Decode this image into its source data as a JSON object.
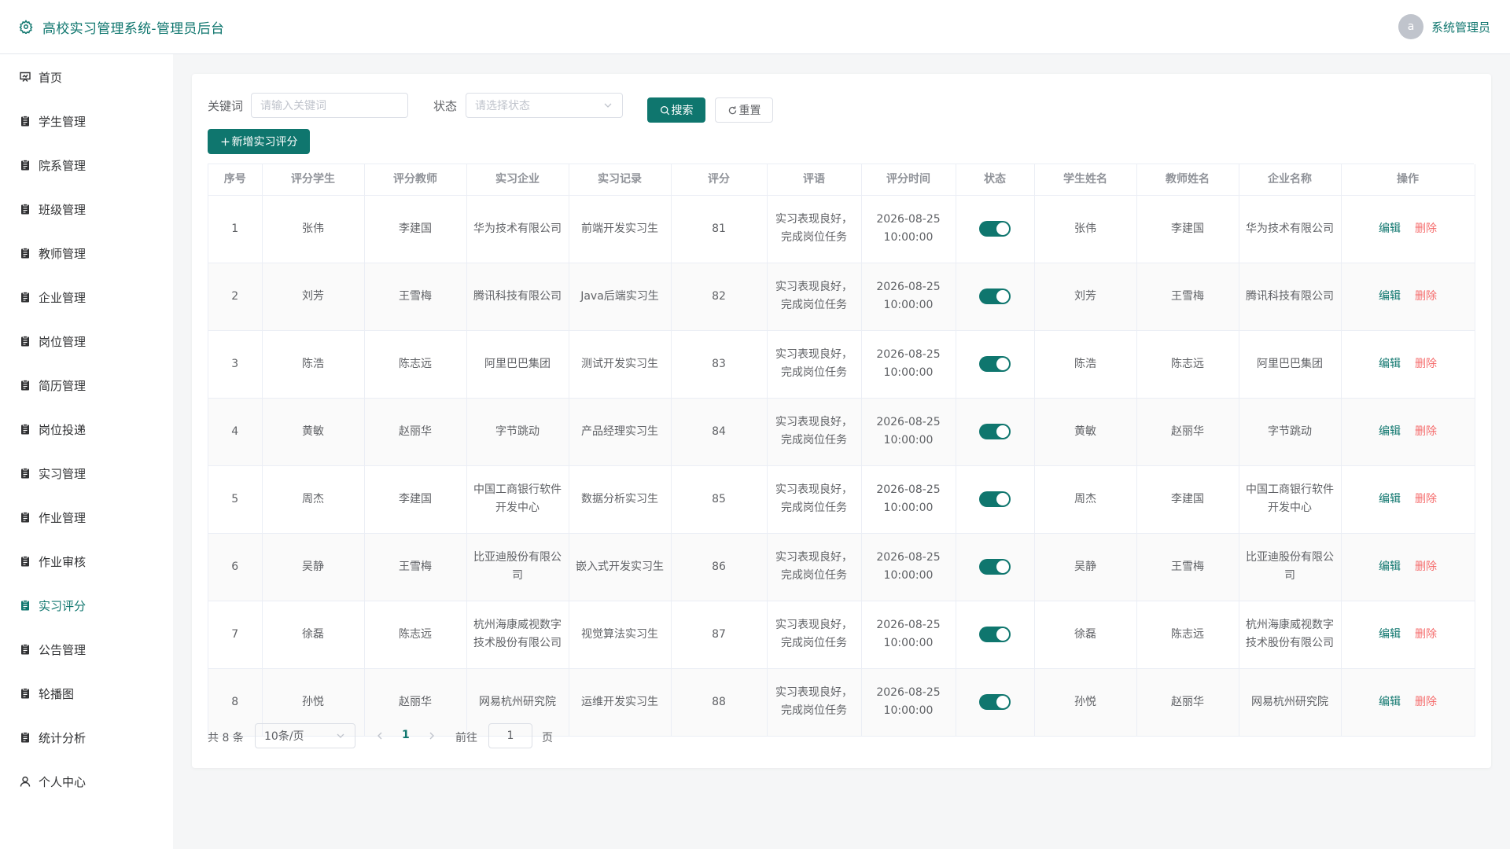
{
  "header": {
    "title": "高校实习管理系统-管理员后台",
    "avatar_letter": "a",
    "user_name": "系统管理员"
  },
  "sidebar": {
    "items": [
      {
        "label": "首页",
        "icon": "home-icon"
      },
      {
        "label": "学生管理",
        "icon": "clipboard-icon"
      },
      {
        "label": "院系管理",
        "icon": "clipboard-icon"
      },
      {
        "label": "班级管理",
        "icon": "clipboard-icon"
      },
      {
        "label": "教师管理",
        "icon": "clipboard-icon"
      },
      {
        "label": "企业管理",
        "icon": "clipboard-icon"
      },
      {
        "label": "岗位管理",
        "icon": "clipboard-icon"
      },
      {
        "label": "简历管理",
        "icon": "clipboard-icon"
      },
      {
        "label": "岗位投递",
        "icon": "clipboard-icon"
      },
      {
        "label": "实习管理",
        "icon": "clipboard-icon"
      },
      {
        "label": "作业管理",
        "icon": "clipboard-icon"
      },
      {
        "label": "作业审核",
        "icon": "clipboard-icon"
      },
      {
        "label": "实习评分",
        "icon": "clipboard-icon",
        "active": true
      },
      {
        "label": "公告管理",
        "icon": "clipboard-icon"
      },
      {
        "label": "轮播图",
        "icon": "clipboard-icon"
      },
      {
        "label": "统计分析",
        "icon": "clipboard-icon"
      },
      {
        "label": "个人中心",
        "icon": "user-icon"
      }
    ]
  },
  "filters": {
    "keyword_label": "关键词",
    "keyword_placeholder": "请输入关键词",
    "status_label": "状态",
    "status_placeholder": "请选择状态",
    "search_label": "搜索",
    "reset_label": "重置",
    "add_label": "新增实习评分"
  },
  "table": {
    "columns": [
      "序号",
      "评分学生",
      "评分教师",
      "实习企业",
      "实习记录",
      "评分",
      "评语",
      "评分时间",
      "状态",
      "学生姓名",
      "教师姓名",
      "企业名称",
      "操作"
    ],
    "rows": [
      {
        "no": "1",
        "student": "张伟",
        "teacher": "李建国",
        "company": "华为技术有限公司",
        "record": "前端开发实习生",
        "score": "81",
        "comment": "实习表现良好，完成岗位任务",
        "time": "2026-08-25 10:00:00",
        "status": true,
        "student_name": "张伟",
        "teacher_name": "李建国",
        "company_name": "华为技术有限公司"
      },
      {
        "no": "2",
        "student": "刘芳",
        "teacher": "王雪梅",
        "company": "腾讯科技有限公司",
        "record": "Java后端实习生",
        "score": "82",
        "comment": "实习表现良好，完成岗位任务",
        "time": "2026-08-25 10:00:00",
        "status": true,
        "student_name": "刘芳",
        "teacher_name": "王雪梅",
        "company_name": "腾讯科技有限公司"
      },
      {
        "no": "3",
        "student": "陈浩",
        "teacher": "陈志远",
        "company": "阿里巴巴集团",
        "record": "测试开发实习生",
        "score": "83",
        "comment": "实习表现良好，完成岗位任务",
        "time": "2026-08-25 10:00:00",
        "status": true,
        "student_name": "陈浩",
        "teacher_name": "陈志远",
        "company_name": "阿里巴巴集团"
      },
      {
        "no": "4",
        "student": "黄敏",
        "teacher": "赵丽华",
        "company": "字节跳动",
        "record": "产品经理实习生",
        "score": "84",
        "comment": "实习表现良好，完成岗位任务",
        "time": "2026-08-25 10:00:00",
        "status": true,
        "student_name": "黄敏",
        "teacher_name": "赵丽华",
        "company_name": "字节跳动"
      },
      {
        "no": "5",
        "student": "周杰",
        "teacher": "李建国",
        "company": "中国工商银行软件开发中心",
        "record": "数据分析实习生",
        "score": "85",
        "comment": "实习表现良好，完成岗位任务",
        "time": "2026-08-25 10:00:00",
        "status": true,
        "student_name": "周杰",
        "teacher_name": "李建国",
        "company_name": "中国工商银行软件开发中心"
      },
      {
        "no": "6",
        "student": "吴静",
        "teacher": "王雪梅",
        "company": "比亚迪股份有限公司",
        "record": "嵌入式开发实习生",
        "score": "86",
        "comment": "实习表现良好，完成岗位任务",
        "time": "2026-08-25 10:00:00",
        "status": true,
        "student_name": "吴静",
        "teacher_name": "王雪梅",
        "company_name": "比亚迪股份有限公司"
      },
      {
        "no": "7",
        "student": "徐磊",
        "teacher": "陈志远",
        "company": "杭州海康威视数字技术股份有限公司",
        "record": "视觉算法实习生",
        "score": "87",
        "comment": "实习表现良好，完成岗位任务",
        "time": "2026-08-25 10:00:00",
        "status": true,
        "student_name": "徐磊",
        "teacher_name": "陈志远",
        "company_name": "杭州海康威视数字技术股份有限公司"
      },
      {
        "no": "8",
        "student": "孙悦",
        "teacher": "赵丽华",
        "company": "网易杭州研究院",
        "record": "运维开发实习生",
        "score": "88",
        "comment": "实习表现良好，完成岗位任务",
        "time": "2026-08-25 10:00:00",
        "status": true,
        "student_name": "孙悦",
        "teacher_name": "赵丽华",
        "company_name": "网易杭州研究院"
      }
    ],
    "edit_label": "编辑",
    "delete_label": "删除"
  },
  "pagination": {
    "total_text": "共 8 条",
    "page_size": "10条/页",
    "current_page": "1",
    "goto_label": "前往",
    "goto_value": "1",
    "page_suffix": "页"
  },
  "colors": {
    "primary": "#0f766e",
    "danger": "#f56c6c"
  }
}
